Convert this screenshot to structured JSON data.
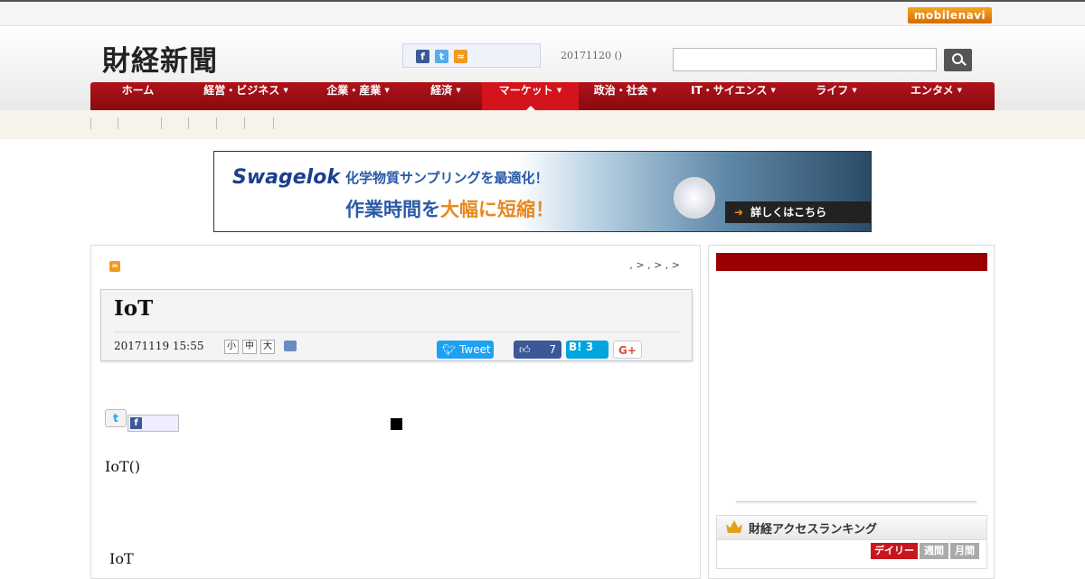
{
  "topbar": {
    "mobile_navi": "mobilenavi"
  },
  "header": {
    "logo": "財経新聞",
    "date": "20171120 ()"
  },
  "nav": [
    {
      "label": "ホーム",
      "caret": false
    },
    {
      "label": "経営・ビジネス",
      "caret": true
    },
    {
      "label": "企業・産業",
      "caret": true
    },
    {
      "label": "経済",
      "caret": true
    },
    {
      "label": "マーケット",
      "caret": true,
      "active": true
    },
    {
      "label": "政治・社会",
      "caret": true
    },
    {
      "label": "IT・サイエンス",
      "caret": true
    },
    {
      "label": "ライフ",
      "caret": true
    },
    {
      "label": "エンタメ",
      "caret": true
    }
  ],
  "banner": {
    "brand": "Swagelok",
    "sub": "化学物質サンプリングを最適化！",
    "main_prefix": "作業時間を",
    "main_highlight": "大幅に短縮！",
    "cta": "詳しくはこちら"
  },
  "article": {
    "breadcrumb": ", > , > , >",
    "title": "IoT",
    "date": "20171119 15:55",
    "font_sizes": [
      "小",
      "中",
      "大"
    ],
    "tweet_label": "Tweet",
    "fb_count": "7",
    "hatena_label": "B!",
    "hatena_count": "3",
    "gplus_label": "G+",
    "body_line1": "IoT()",
    "body_line2": "IoT"
  },
  "sidebar": {
    "ranking_title": "財経アクセスランキング",
    "tabs": [
      "デイリー",
      "週間",
      "月間"
    ]
  },
  "colors": {
    "nav_red": "#b0121a",
    "nav_active": "#d4141c",
    "banner_blue": "#2a5aa6",
    "banner_orange": "#e7891c"
  }
}
